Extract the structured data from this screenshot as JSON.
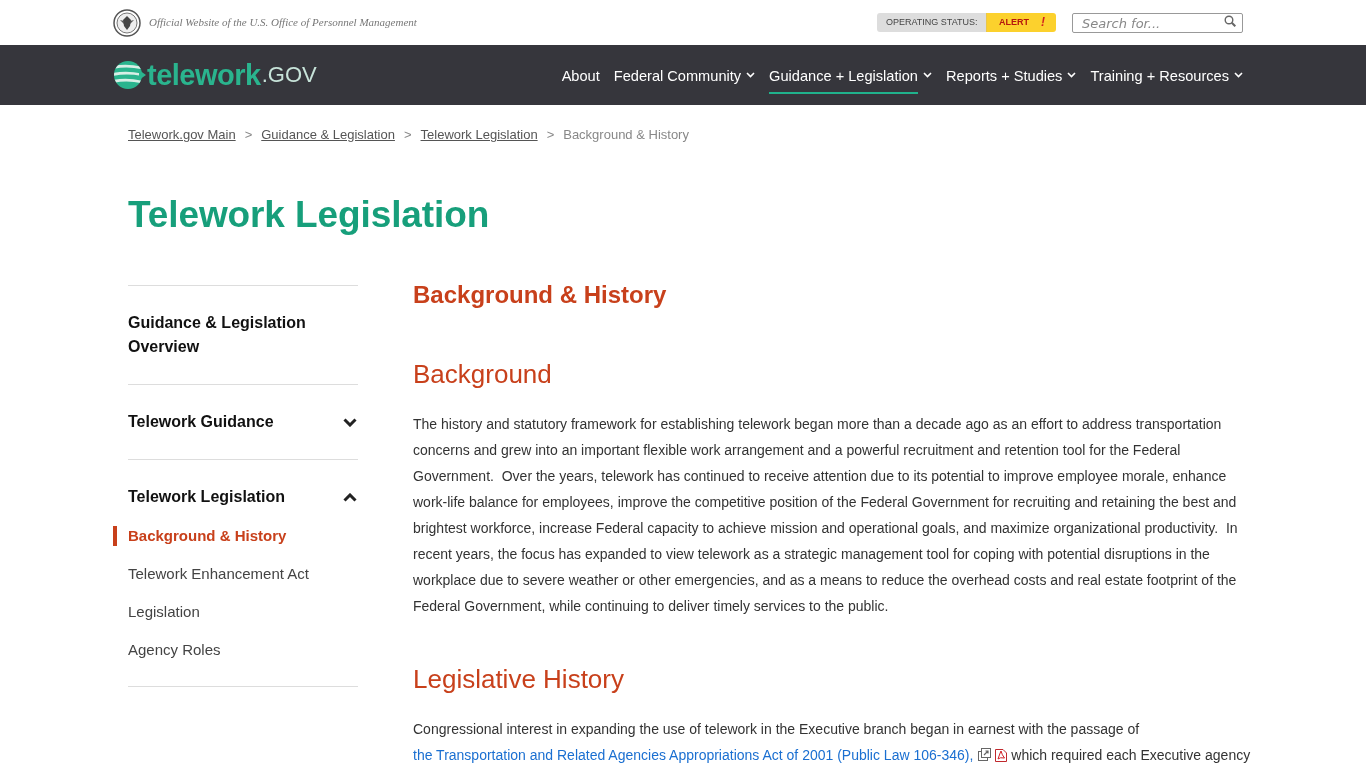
{
  "header": {
    "tagline": "Official Website of the U.S. Office of Personnel Management",
    "status": {
      "label": "OPERATING STATUS:",
      "value": "ALERT",
      "mark": "!"
    },
    "search": {
      "placeholder": "Search for..."
    }
  },
  "navbar": {
    "logo": {
      "text": "telework",
      "suffix": ".GOV"
    },
    "items": [
      {
        "label": "About",
        "dropdown": false,
        "selected": false
      },
      {
        "label": "Federal Community",
        "dropdown": true,
        "selected": false
      },
      {
        "label": "Guidance + Legislation",
        "dropdown": true,
        "selected": true
      },
      {
        "label": "Reports + Studies",
        "dropdown": true,
        "selected": false
      },
      {
        "label": "Training + Resources",
        "dropdown": true,
        "selected": false
      }
    ]
  },
  "breadcrumb": [
    {
      "kind": "link",
      "text": "Telework.gov Main"
    },
    {
      "kind": "separator",
      "text": ">"
    },
    {
      "kind": "link",
      "text": "Guidance & Legislation"
    },
    {
      "kind": "separator",
      "text": ">"
    },
    {
      "kind": "link",
      "text": "Telework Legislation"
    },
    {
      "kind": "separator",
      "text": ">"
    },
    {
      "kind": "current",
      "text": "Background & History"
    }
  ],
  "page_title": "Telework Legislation",
  "sidebar": {
    "sections": [
      {
        "kind": "link",
        "label": "Guidance & Legislation Overview"
      },
      {
        "kind": "group",
        "label": "Telework Guidance",
        "expanded": false
      },
      {
        "kind": "group",
        "label": "Telework Legislation",
        "expanded": true,
        "children": [
          {
            "label": "Background & History",
            "selected": true
          },
          {
            "label": "Telework Enhancement Act",
            "selected": false
          },
          {
            "label": "Legislation",
            "selected": false
          },
          {
            "label": "Agency Roles",
            "selected": false
          }
        ]
      }
    ]
  },
  "content": {
    "title": "Background & History",
    "sections": [
      {
        "heading": "Background",
        "paragraphs": [
          {
            "parts": [
              {
                "kind": "text",
                "text": "The history and statutory framework for establishing telework began more than a decade ago as an effort to address transportation concerns and grew into an important flexible work arrangement and a powerful recruitment and retention tool for the Federal Government.  Over the years, telework has continued to receive attention due to its potential to improve employee morale, enhance work-life balance for employees, improve the competitive position of the Federal Government for recruiting and retaining the best and brightest workforce, increase Federal capacity to achieve mission and operational goals, and maximize organizational productivity.  In recent years, the focus has expanded to view telework as a strategic management tool for coping with potential disruptions in the workplace due to severe weather or other emergencies, and as a means to reduce the overhead costs and real estate footprint of the Federal Government, while continuing to deliver timely services to the public."
              }
            ]
          }
        ]
      },
      {
        "heading": "Legislative History",
        "paragraphs": [
          {
            "parts": [
              {
                "kind": "text",
                "text": "Congressional interest in expanding the use of telework in the Executive branch began in earnest with the passage of"
              },
              {
                "kind": "link",
                "text": "the Transportation and Related Agencies Appropriations Act of 2001 (Public Law 106-346),",
                "external": true,
                "pdf": true
              },
              {
                "kind": "text",
                "text": "which required each Executive agency"
              }
            ]
          }
        ]
      }
    ]
  }
}
